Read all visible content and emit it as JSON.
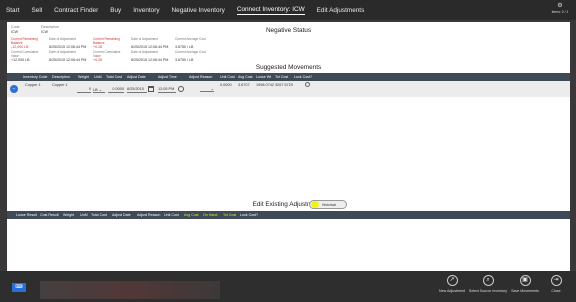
{
  "nav": {
    "items": [
      "Start",
      "Sell",
      "Contract Finder",
      "Buy",
      "Inventory",
      "Negative Inventory",
      "Connect Inventory: ICW",
      "Edit Adjustments"
    ],
    "corner_label": "Items: 0 / 1"
  },
  "header": {
    "code_label": "Code",
    "code_value": "ICW",
    "desc_label": "Description",
    "desc_value": "ICW",
    "row1": [
      "Current Remaining Balance",
      "Date of Adjustment",
      "Current Remaining Balance",
      "Date of Adjustment",
      "Current Average Cost"
    ],
    "row1_vals": [
      "-12,000 LB",
      "8/25/2015 12:06:44 PM",
      "+0.28",
      "8/25/2015 12:06:44 PM",
      "3.6750 / LB"
    ],
    "row2": [
      "Current Cumulative Value",
      "Date of Adjustment",
      "Current Cumulative Value",
      "Date of Adjustment",
      "Current Average Cost"
    ],
    "row2_vals": [
      "+12,000 LB",
      "8/25/2015 12:06:44 PM",
      "+0.28",
      "8/25/2015 12:06:44 PM",
      "3.6750 / LB"
    ]
  },
  "negative_title": "Negative Status",
  "suggested": {
    "title": "Suggested Movements",
    "columns": [
      "Inventory Code",
      "Description",
      "Weight",
      "UoM",
      "Total Cost",
      "Adjust Date",
      "Adjust Time",
      "Adjust Reason",
      "Unit Cost",
      "Avg Cost",
      "Loose Wt",
      "Tot Cost",
      "Lock Cost?"
    ],
    "row": {
      "code": "Copper 1",
      "description": "Copper 1",
      "weight": "0",
      "uom": "LB",
      "total_cost": "0.0000",
      "adjust_date": "8/25/2015",
      "adjust_time": "12:05 PM",
      "unit_cost": "0.0000",
      "avg_cost": "3.6707",
      "loose_wt": "1998.0742",
      "tot_cost": "3267.5729"
    }
  },
  "edit": {
    "title": "Edit Existing Adjustments",
    "toggle_label": "Historical",
    "columns": [
      "Loose Result",
      "Cost Result",
      "Weight",
      "UoM",
      "Total Cost",
      "Adjust Date",
      "Adjust Reason",
      "Unit Cost",
      "Avg Cost",
      "On Hand",
      "Tot Cost",
      "Lock Cost?"
    ],
    "yellow_columns": [
      8,
      9,
      10
    ]
  },
  "bottom_buttons": [
    "New Adjustment",
    "Select Source Inventory",
    "Save Movements",
    "Close"
  ],
  "colors": {
    "accent_blue": "#2f6fd6",
    "header_bar": "#3e4a55",
    "toggle_yellow": "#f2f218",
    "red_text": "#d93030"
  }
}
